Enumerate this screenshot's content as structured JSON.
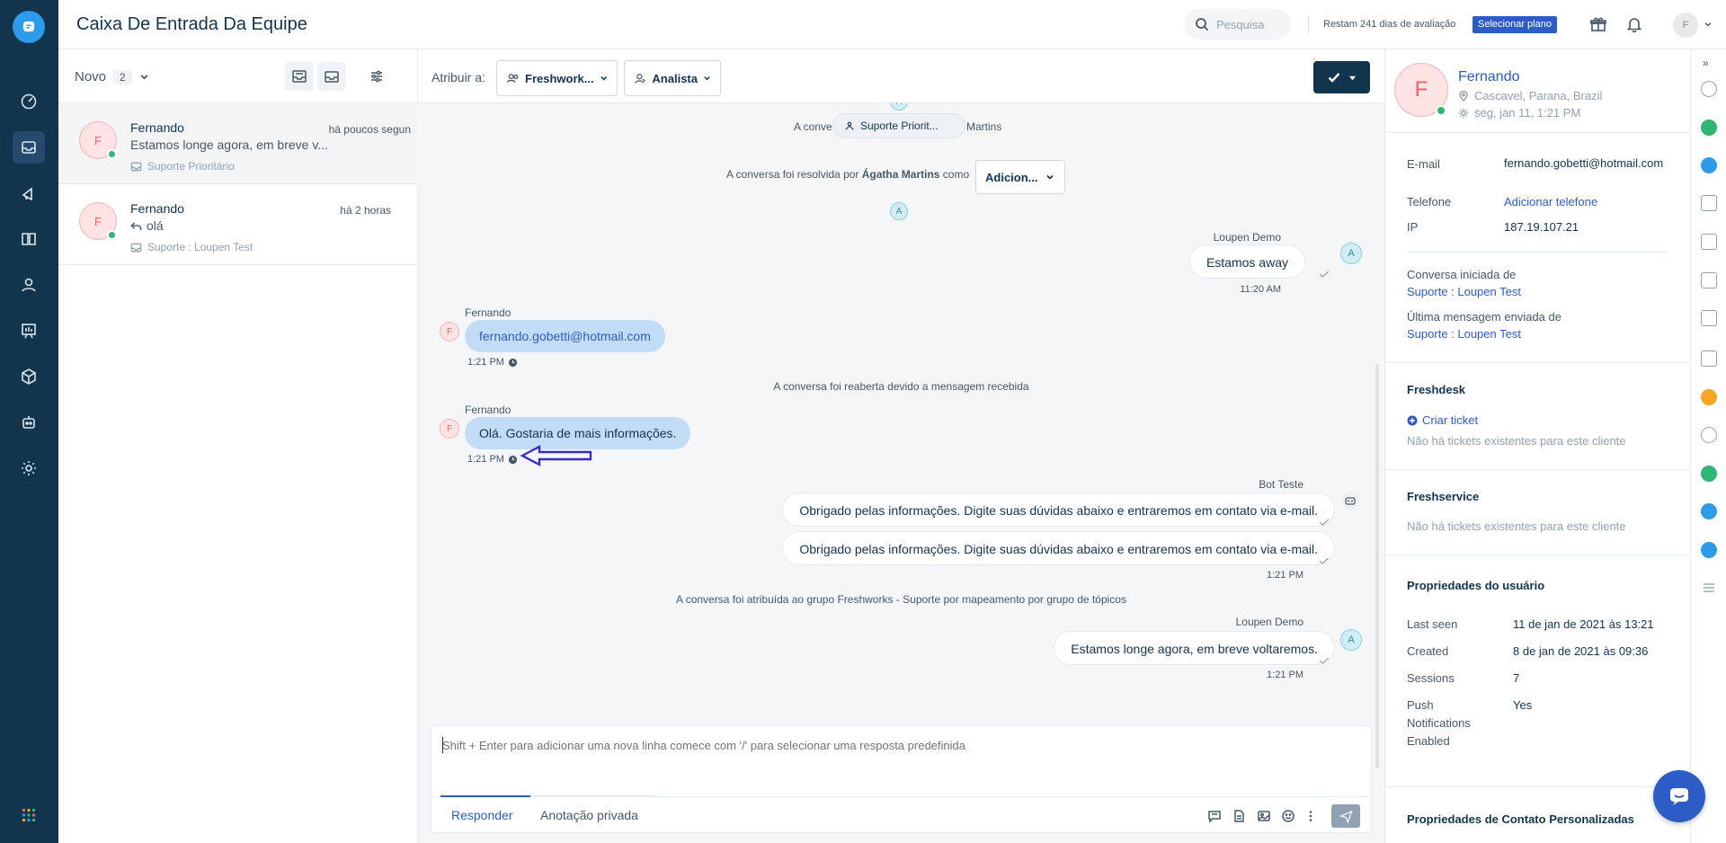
{
  "header": {
    "title": "Caixa De Entrada Da Equipe",
    "search_placeholder": "Pesquisa",
    "trial_text": "Restam 241 dias de avaliação",
    "plan_button": "Selecionar plano",
    "avatar_initial": "F"
  },
  "nav": {
    "items": [
      "dashboard-icon",
      "inbox-icon",
      "campaigns-icon",
      "knowledge-base-icon",
      "contacts-icon",
      "reports-icon",
      "integrations-icon",
      "bot-icon",
      "settings-icon"
    ],
    "active": "inbox-icon"
  },
  "list": {
    "filter_label": "Novo",
    "count": "2",
    "conversations": [
      {
        "initial": "F",
        "name": "Fernando",
        "time": "há poucos segun",
        "preview": "Estamos longe agora, em breve v...",
        "group": "Suporte Prioritário"
      },
      {
        "initial": "F",
        "name": "Fernando",
        "time": "há 2 horas",
        "preview": "olá",
        "group": "Suporte : Loupen Test"
      }
    ]
  },
  "toolbar": {
    "assign_label": "Atribuir a:",
    "group_button": "Freshwork...",
    "agent_button": "Analista"
  },
  "messages": {
    "sys_assigned_prefix": "A conve",
    "sys_assigned_suffix": "Martins",
    "pill_group": "Suporte Priorit...",
    "avatar_a": "A",
    "resolved_prefix": "A conversa foi resolvida por",
    "resolved_agent": "Ágatha Martins",
    "resolved_suffix": "como",
    "resolved_dropdown": "Adicion...",
    "agent_name": "Loupen Demo",
    "agent_msg_1": "Estamos away",
    "agent_time_1": "11:20 AM",
    "customer_name": "Fernando",
    "customer_initial": "F",
    "customer_msg_1": "fernando.gobetti@hotmail.com",
    "customer_time_1": "1:21 PM",
    "sys_reopened": "A conversa foi reaberta devido a mensagem recebida",
    "customer_msg_2": "Olá. Gostaria de mais informações.",
    "customer_time_2": "1:21 PM",
    "bot_name": "Bot Teste",
    "bot_msg_1": "Obrigado pelas informações. Digite suas dúvidas abaixo e entraremos em contato via e-mail.",
    "bot_msg_2": "Obrigado pelas informações. Digite suas dúvidas abaixo e entraremos em contato via e-mail.",
    "bot_time": "1:21 PM",
    "sys_group_assign": "A conversa foi atribuída ao grupo Freshworks - Suporte por mapeamento por grupo de tópicos",
    "agent_msg_2": "Estamos longe agora, em breve voltaremos.",
    "agent_time_2": "1:21 PM"
  },
  "composer": {
    "placeholder": "Shift + Enter para adicionar uma nova linha comece com '/' para selecionar uma resposta predefinida",
    "tab_reply": "Responder",
    "tab_note": "Anotação privada"
  },
  "contact": {
    "initial": "F",
    "name": "Fernando",
    "location": "Cascavel, Parana, Brazil",
    "local_time": "seg, jan 11, 1:21 PM",
    "email_label": "E-mail",
    "email": "fernando.gobetti@hotmail.com",
    "phone_label": "Telefone",
    "phone_action": "Adicionar telefone",
    "ip_label": "IP",
    "ip": "187.19.107.21",
    "started_label": "Conversa iniciada de",
    "started_value": "Suporte : Loupen Test",
    "last_msg_label": "Última mensagem enviada de",
    "last_msg_value": "Suporte : Loupen Test",
    "freshdesk_title": "Freshdesk",
    "create_ticket": "Criar ticket",
    "freshdesk_empty": "Não há tickets existentes para este cliente",
    "freshservice_title": "Freshservice",
    "freshservice_empty": "Não há tickets existentes para este cliente",
    "user_props_title": "Propriedades do usuário",
    "props": [
      {
        "label": "Last seen",
        "value": "11 de jan de 2021 às 13:21"
      },
      {
        "label": "Created",
        "value": "8 de jan de 2021 às 09:36"
      },
      {
        "label": "Sessions",
        "value": "7"
      },
      {
        "label": "Push Notifications Enabled",
        "value": "Yes"
      }
    ],
    "custom_props_title": "Propriedades de Contato Personalizadas"
  },
  "colors": {
    "nav_bg": "#12344d",
    "accent": "#2c5cc5",
    "customer_bubble": "#c3dcf5",
    "annotation_arrow": "#3a2ec0"
  }
}
